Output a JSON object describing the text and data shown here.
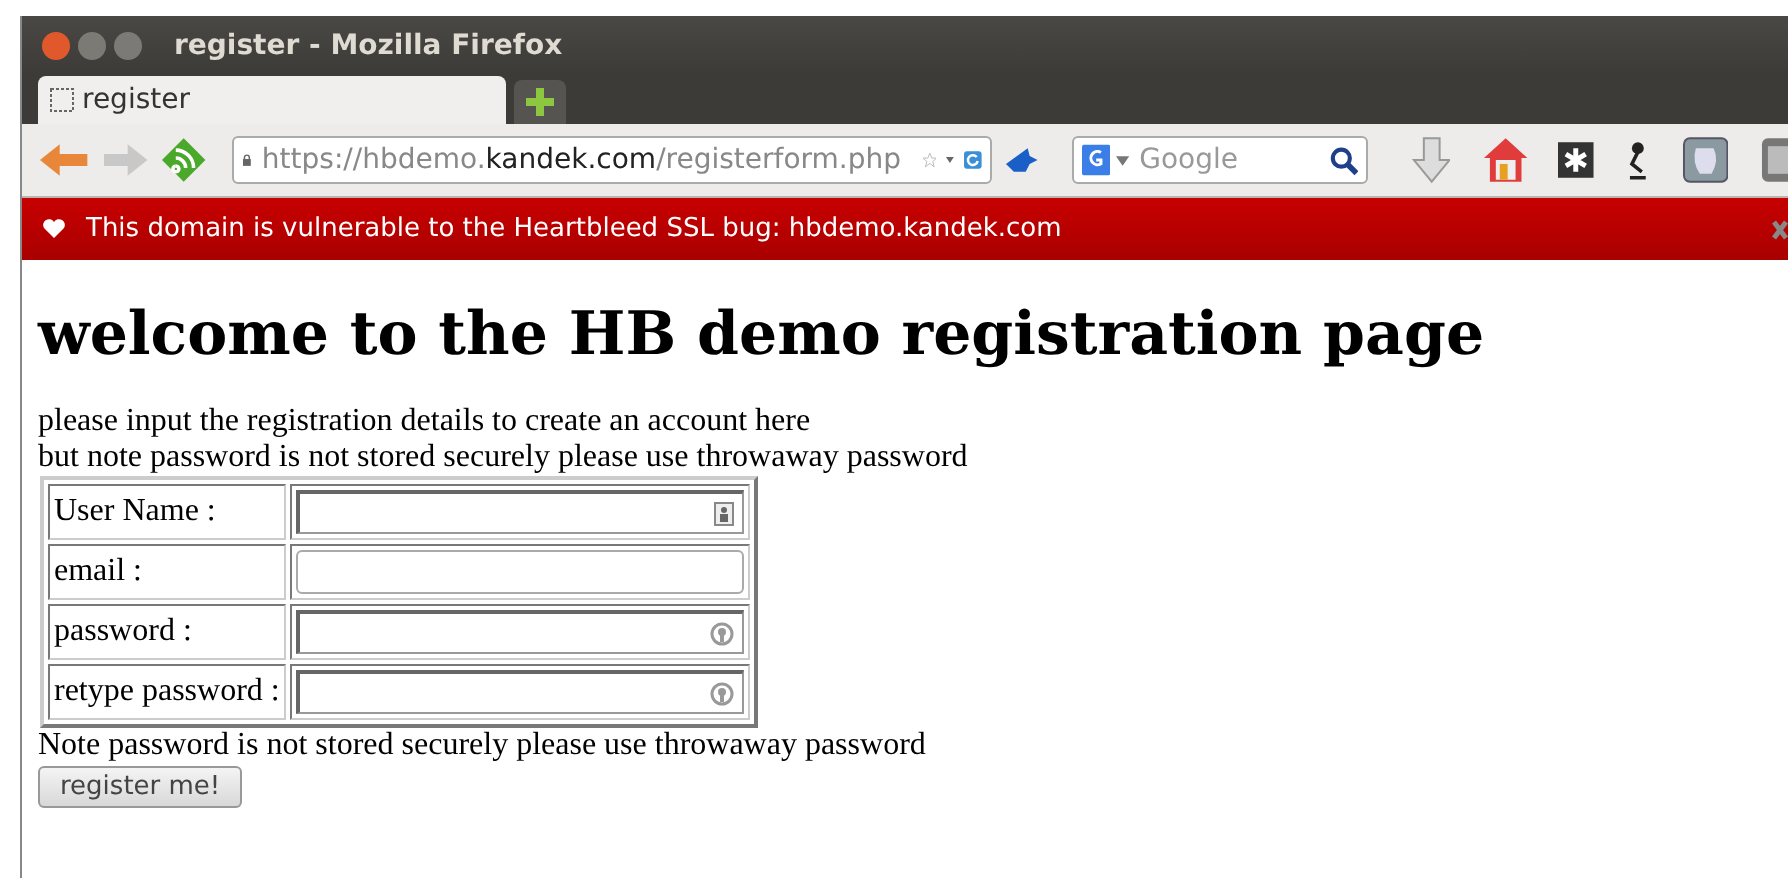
{
  "window": {
    "title": "register - Mozilla Firefox"
  },
  "tabs": [
    {
      "label": "register",
      "selected": true
    }
  ],
  "url": {
    "parts": [
      {
        "text": "https://hbdemo.",
        "kind": "dim"
      },
      {
        "text": "kandek.com",
        "kind": "host"
      },
      {
        "text": "/registerform.php",
        "kind": "dim"
      }
    ]
  },
  "search": {
    "placeholder": "Google"
  },
  "notification": {
    "text": "This domain is vulnerable to the Heartbleed SSL bug: hbdemo.kandek.com"
  },
  "page": {
    "heading": "welcome to the HB demo registration page",
    "intro": [
      "please input the registration details to create an account here",
      "but note password is not stored securely please use throwaway password"
    ],
    "fields": [
      {
        "label": "User Name :",
        "kind": "user"
      },
      {
        "label": "email :",
        "kind": "plain"
      },
      {
        "label": "password :",
        "kind": "password"
      },
      {
        "label": "retype password :",
        "kind": "password"
      }
    ],
    "note": "Note password is not stored securely please use throwaway password",
    "button": "register me!"
  }
}
